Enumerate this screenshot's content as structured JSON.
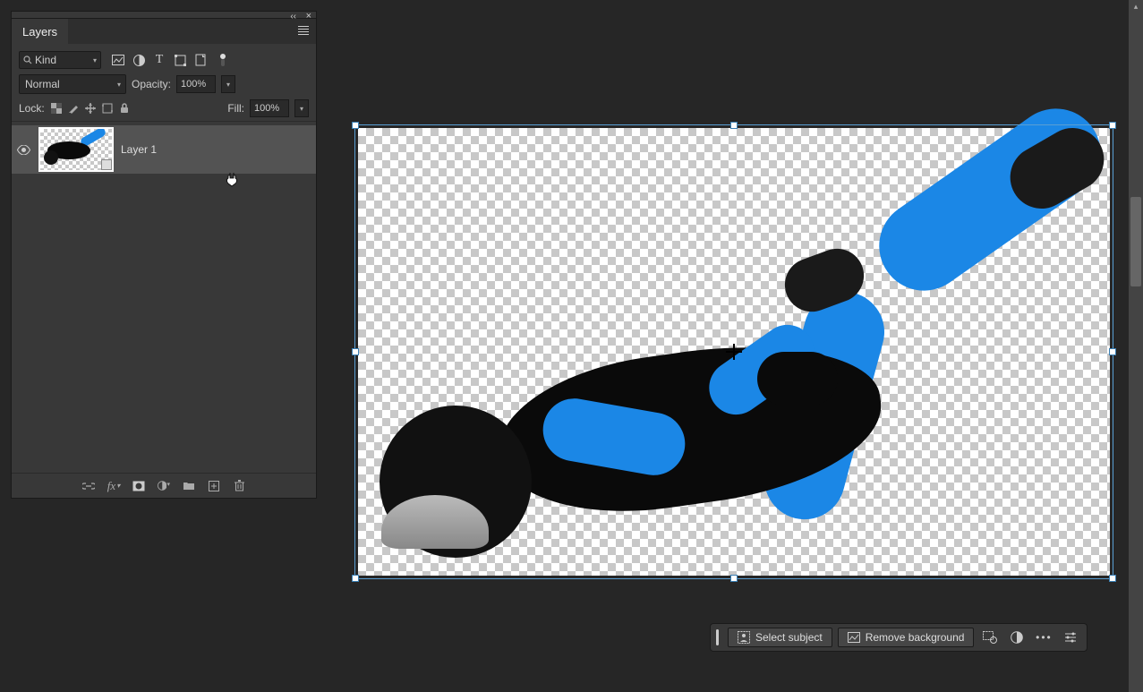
{
  "panel": {
    "title": "Layers",
    "filter_label": "Kind",
    "blend_mode": "Normal",
    "opacity_label": "Opacity:",
    "opacity_value": "100%",
    "lock_label": "Lock:",
    "fill_label": "Fill:",
    "fill_value": "100%"
  },
  "layers": [
    {
      "name": "Layer 1",
      "visible": true
    }
  ],
  "quick_actions": {
    "select_subject": "Select subject",
    "remove_background": "Remove background"
  }
}
